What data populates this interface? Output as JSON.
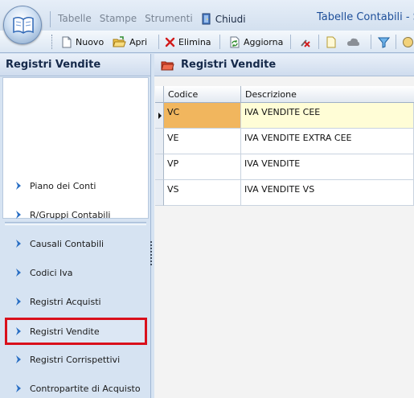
{
  "app": {
    "title": "Tabelle Contabili - Sc",
    "menu": [
      "Tabelle",
      "Stampe",
      "Strumenti"
    ],
    "close_label": "Chiudi"
  },
  "toolbar": {
    "new_label": "Nuovo",
    "open_label": "Apri",
    "delete_label": "Elimina",
    "refresh_label": "Aggiorna"
  },
  "left_panel": {
    "title": "Registri Vendite",
    "nav_items": [
      {
        "label": "Piano dei Conti",
        "icon": "chevron-right-icon"
      },
      {
        "label": "R/Gruppi Contabili",
        "icon": "chevron-right-icon"
      },
      {
        "label": "Causali Contabili",
        "icon": "chevron-right-icon"
      },
      {
        "label": "Codici Iva",
        "icon": "chevron-right-icon"
      },
      {
        "label": "Registri Acquisti",
        "icon": "chevron-right-icon"
      },
      {
        "label": "Registri Vendite",
        "icon": "chevron-right-icon",
        "selected": true
      },
      {
        "label": "Registri Corrispettivi",
        "icon": "chevron-right-icon"
      },
      {
        "label": "Contropartite di Acquisto",
        "icon": "chevron-right-icon"
      }
    ]
  },
  "right_panel": {
    "title": "Registri Vendite",
    "columns": [
      "Codice",
      "Descrizione"
    ],
    "rows": [
      {
        "codice": "VC",
        "descrizione": "IVA VENDITE CEE",
        "selected": true
      },
      {
        "codice": "VE",
        "descrizione": "IVA VENDITE EXTRA CEE"
      },
      {
        "codice": "VP",
        "descrizione": "IVA VENDITE"
      },
      {
        "codice": "VS",
        "descrizione": "IVA VENDITE VS"
      }
    ]
  },
  "colors": {
    "accent": "#1e4f9a",
    "selection_highlight": "#d9101c",
    "selected_cell": "#f1b65e",
    "selected_row": "#fffdd6"
  }
}
